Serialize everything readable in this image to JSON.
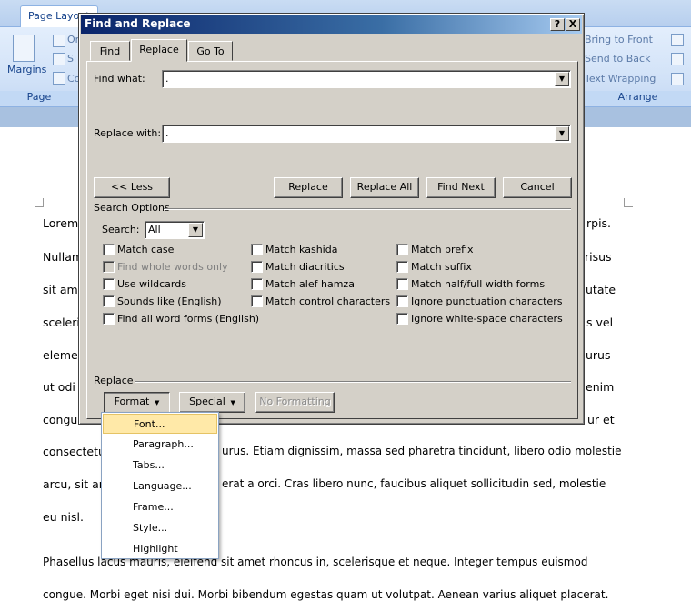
{
  "ribbon": {
    "active_tab": "Page Layout",
    "margins_label": "Margins",
    "group_page_label_partial": "Page",
    "group_arrange_label": "Arrange",
    "bring_to_front": "Bring to Front",
    "send_to_back": "Send to Back",
    "text_wrapping": "Text Wrapping",
    "partial_tabs": [
      "Or",
      "Si",
      "Co"
    ]
  },
  "document": {
    "lines": [
      {
        "left": "Lorem",
        "right": "rpis."
      },
      {
        "left": "Nullam",
        "right": "risus"
      },
      {
        "left": "sit am",
        "right": "utate"
      },
      {
        "left": "sceleri",
        "right": "s vel"
      },
      {
        "left": "elemen",
        "right": "urus"
      },
      {
        "left": "ut odi",
        "right": "enim"
      },
      {
        "left": "congu",
        "right": "ur et"
      },
      {
        "left": "consectetu",
        "right": "urus. Etiam dignissim, massa sed pharetra tincidunt, libero odio molestie"
      },
      {
        "left": "arcu, sit an",
        "right": "erat a orci. Cras libero nunc, faucibus aliquet sollicitudin sed, molestie"
      },
      {
        "left": "eu nisl.",
        "right": ""
      }
    ],
    "para2_line1": "Phasellus lacus mauris, eleifend sit amet rhoncus in, scelerisque et neque. Integer tempus euismod",
    "para2_line2": "congue. Morbi eget nisi dui. Morbi bibendum egestas quam ut volutpat. Aenean varius aliquet placerat."
  },
  "dialog": {
    "title": "Find and Replace",
    "help_button": "?",
    "close_button": "X",
    "tabs": [
      {
        "label": "Find",
        "active": false
      },
      {
        "label": "Replace",
        "active": true
      },
      {
        "label": "Go To",
        "active": false
      }
    ],
    "find_what_label": "Find what:",
    "find_what_value": ".",
    "replace_with_label": "Replace with:",
    "replace_with_value": ".",
    "buttons": {
      "less": "<< Less",
      "replace": "Replace",
      "replace_all": "Replace All",
      "find_next": "Find Next",
      "cancel": "Cancel"
    },
    "search_options_label": "Search Options",
    "search_label": "Search:",
    "search_value": "All",
    "options_col1": [
      {
        "label": "Match case",
        "checked": false,
        "disabled": false
      },
      {
        "label": "Find whole words only",
        "checked": false,
        "disabled": true
      },
      {
        "label": "Use wildcards",
        "checked": false,
        "disabled": false
      },
      {
        "label": "Sounds like (English)",
        "checked": false,
        "disabled": false
      },
      {
        "label": "Find all word forms (English)",
        "checked": false,
        "disabled": false
      }
    ],
    "options_col2": [
      {
        "label": "Match kashida",
        "checked": false
      },
      {
        "label": "Match diacritics",
        "checked": false
      },
      {
        "label": "Match alef hamza",
        "checked": false
      },
      {
        "label": "Match control characters",
        "checked": false
      }
    ],
    "options_col3": [
      {
        "label": "Match prefix",
        "checked": false
      },
      {
        "label": "Match suffix",
        "checked": false
      },
      {
        "label": "Match half/full width forms",
        "checked": false
      },
      {
        "label": "Ignore punctuation characters",
        "checked": false
      },
      {
        "label": "Ignore white-space characters",
        "checked": false
      }
    ],
    "replace_section_label": "Replace",
    "format_button": "Format",
    "special_button": "Special",
    "no_formatting_button": "No Formatting"
  },
  "format_menu": {
    "items": [
      "Font...",
      "Paragraph...",
      "Tabs...",
      "Language...",
      "Frame...",
      "Style...",
      "Highlight"
    ],
    "hover_index": 0
  }
}
